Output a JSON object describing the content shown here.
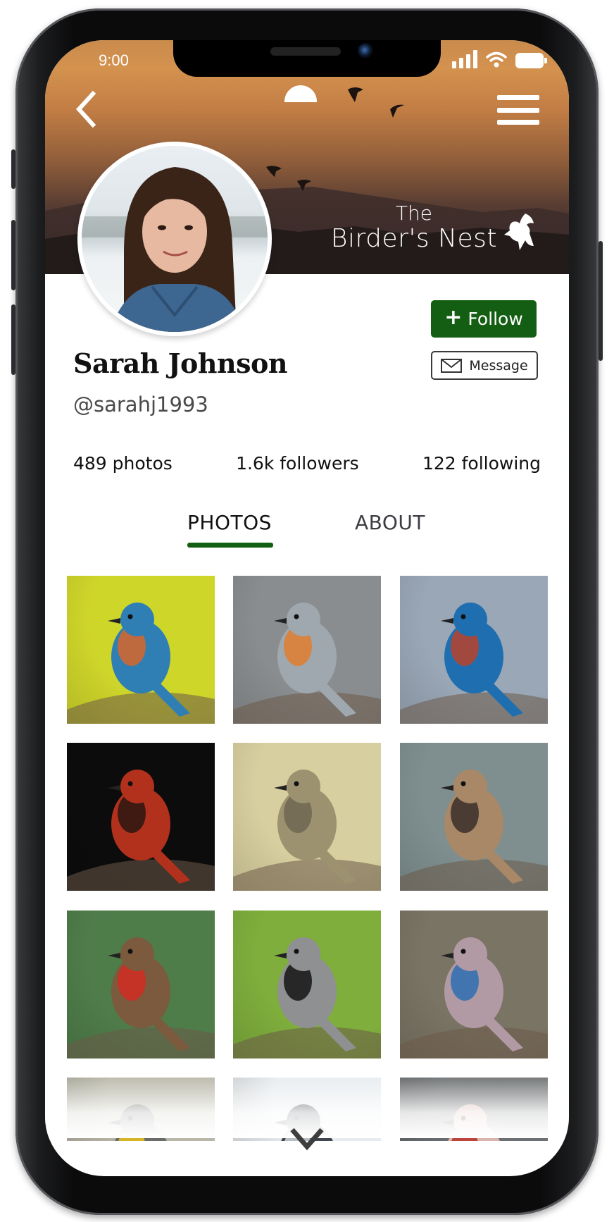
{
  "status_bar": {
    "time": "9:00",
    "icons": [
      "cellular-signal-icon",
      "wifi-icon",
      "battery-icon"
    ]
  },
  "header": {
    "back_icon": "chevron-left-icon",
    "menu_icon": "hamburger-menu-icon",
    "brand": {
      "line1": "The",
      "line2": "Birder's Nest",
      "logo_icon": "flying-bird-icon"
    }
  },
  "profile": {
    "name": "Sarah Johnson",
    "handle": "@sarahj1993",
    "avatar_alt": "Profile photo of Sarah Johnson"
  },
  "actions": {
    "follow_icon": "+",
    "follow_label": "Follow",
    "message_icon": "envelope-icon",
    "message_label": "Message"
  },
  "stats": [
    {
      "label": "489 photos"
    },
    {
      "label": "1.6k followers"
    },
    {
      "label": "122 following"
    }
  ],
  "tabs": [
    {
      "label": "PHOTOS",
      "active": true
    },
    {
      "label": "ABOUT",
      "active": false
    }
  ],
  "photos": [
    {
      "subject": "Kingfisher",
      "bg": "#cfd62a",
      "bird": "#2f7fb5",
      "accent": "#d8652a"
    },
    {
      "subject": "European robin",
      "bg": "#8a8d8f",
      "bird": "#9ea8ae",
      "accent": "#e07c2e"
    },
    {
      "subject": "Blue bird",
      "bg": "#9aa7b6",
      "bird": "#1f6fb0",
      "accent": "#b8432a"
    },
    {
      "subject": "Northern cardinal",
      "bg": "#0c0c0c",
      "bird": "#b1311c",
      "accent": "#2a1612"
    },
    {
      "subject": "Finch",
      "bg": "#d7cf9f",
      "bird": "#9c9270",
      "accent": "#6f6650"
    },
    {
      "subject": "House sparrow",
      "bg": "#7f8f8f",
      "bird": "#a88866",
      "accent": "#3b2f2a"
    },
    {
      "subject": "Red-whiskered bulbul",
      "bg": "#4f7d4a",
      "bird": "#7b5a3e",
      "accent": "#d22b22"
    },
    {
      "subject": "Great tit",
      "bg": "#7fae3c",
      "bird": "#8e9092",
      "accent": "#151515"
    },
    {
      "subject": "Eurasian jay",
      "bg": "#7a7464",
      "bird": "#b29aa5",
      "accent": "#2e6fb0"
    },
    {
      "subject": "Meadowlark",
      "bg": "#b9b8a8",
      "bird": "#6a6c6a",
      "accent": "#e9c21d"
    },
    {
      "subject": "Junco",
      "bg": "#e8ecef",
      "bird": "#3f4650",
      "accent": "#cfd3d6"
    },
    {
      "subject": "Goldfinch",
      "bg": "#6d7072",
      "bird": "#d9b6ad",
      "accent": "#b8312a"
    }
  ],
  "scroll_icon": "chevron-down-icon",
  "colors": {
    "accent_green": "#135e13",
    "text_dark": "#111111",
    "text_muted": "#4a4a4a"
  }
}
